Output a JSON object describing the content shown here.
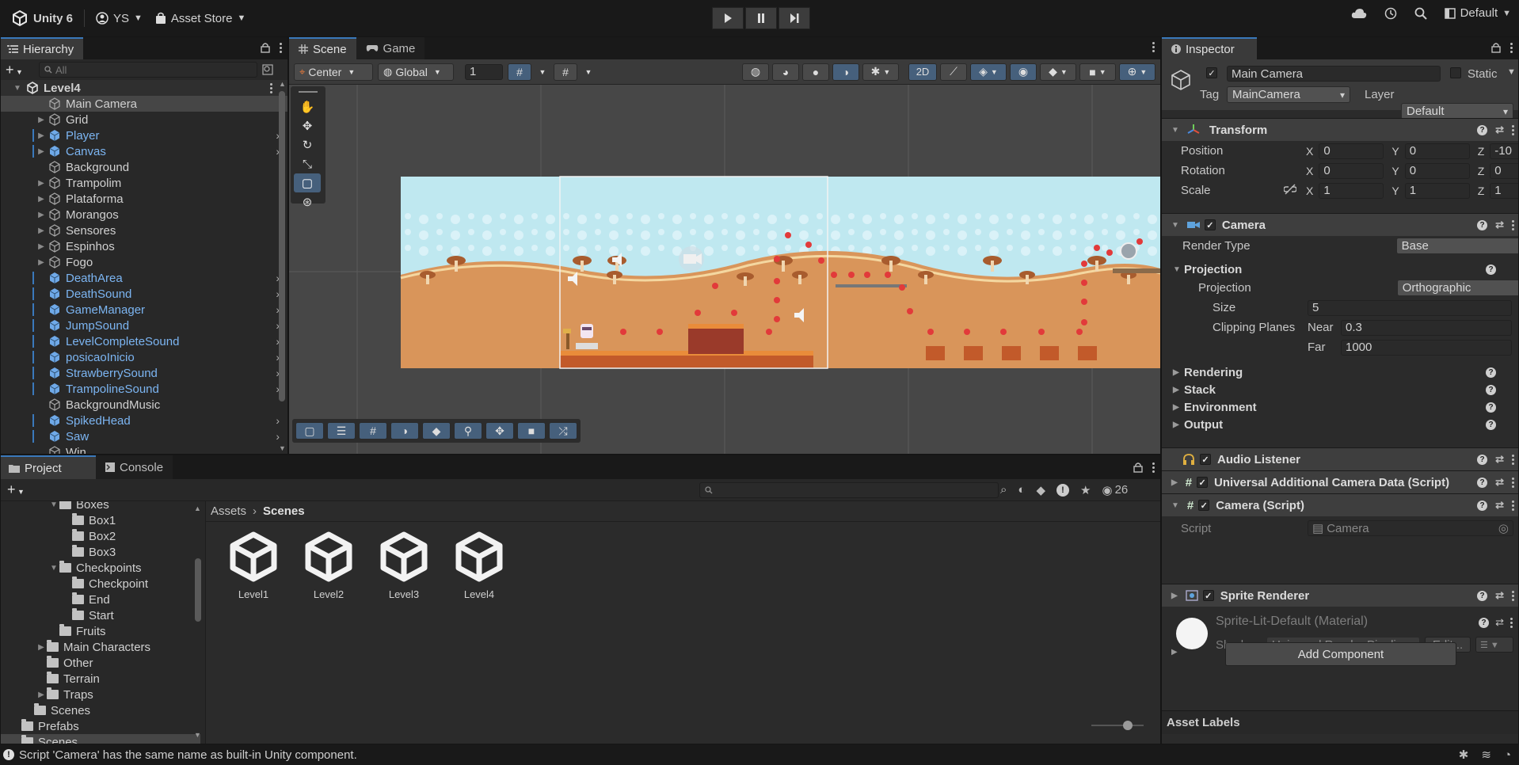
{
  "topbar": {
    "app_name": "Unity 6",
    "account": "YS",
    "asset_store": "Asset Store",
    "layout": "Default"
  },
  "hierarchy": {
    "tab": "Hierarchy",
    "search_placeholder": "All",
    "scene_name": "Level4",
    "items": [
      {
        "label": "Main Camera",
        "prefab": false,
        "fold": false,
        "selected": true,
        "chev": false
      },
      {
        "label": "Grid",
        "prefab": false,
        "fold": true,
        "chev": false
      },
      {
        "label": "Player",
        "prefab": true,
        "fold": true,
        "chev": true
      },
      {
        "label": "Canvas",
        "prefab": true,
        "fold": true,
        "chev": true
      },
      {
        "label": "Background",
        "prefab": false,
        "fold": false,
        "chev": false
      },
      {
        "label": "Trampolim",
        "prefab": false,
        "fold": true,
        "chev": false
      },
      {
        "label": "Plataforma",
        "prefab": false,
        "fold": true,
        "chev": false
      },
      {
        "label": "Morangos",
        "prefab": false,
        "fold": true,
        "chev": false
      },
      {
        "label": "Sensores",
        "prefab": false,
        "fold": true,
        "chev": false
      },
      {
        "label": "Espinhos",
        "prefab": false,
        "fold": true,
        "chev": false
      },
      {
        "label": "Fogo",
        "prefab": false,
        "fold": true,
        "chev": false
      },
      {
        "label": "DeathArea",
        "prefab": true,
        "fold": false,
        "chev": true
      },
      {
        "label": "DeathSound",
        "prefab": true,
        "fold": false,
        "chev": true
      },
      {
        "label": "GameManager",
        "prefab": true,
        "fold": false,
        "chev": true
      },
      {
        "label": "JumpSound",
        "prefab": true,
        "fold": false,
        "chev": true
      },
      {
        "label": "LevelCompleteSound",
        "prefab": true,
        "fold": false,
        "chev": true
      },
      {
        "label": "posicaoInicio",
        "prefab": true,
        "fold": false,
        "chev": true
      },
      {
        "label": "StrawberrySound",
        "prefab": true,
        "fold": false,
        "chev": true
      },
      {
        "label": "TrampolineSound",
        "prefab": true,
        "fold": false,
        "chev": true
      },
      {
        "label": "BackgroundMusic",
        "prefab": false,
        "fold": false,
        "chev": false
      },
      {
        "label": "SpikedHead",
        "prefab": true,
        "fold": false,
        "chev": true
      },
      {
        "label": "Saw",
        "prefab": true,
        "fold": false,
        "chev": true
      },
      {
        "label": "Win",
        "prefab": false,
        "fold": false,
        "chev": false
      }
    ]
  },
  "scene": {
    "tabs": [
      "Scene",
      "Game"
    ],
    "pivot": "Center",
    "space": "Global",
    "grid_size": "1",
    "mode_2d": "2D"
  },
  "inspector": {
    "tab": "Inspector",
    "object_name": "Main Camera",
    "static_label": "Static",
    "tag_label": "Tag",
    "tag_value": "MainCamera",
    "layer_label": "Layer",
    "layer_value": "Default",
    "transform": {
      "title": "Transform",
      "position_label": "Position",
      "rotation_label": "Rotation",
      "scale_label": "Scale",
      "position": [
        "0",
        "0",
        "-10"
      ],
      "rotation": [
        "0",
        "0",
        "0"
      ],
      "scale": [
        "1",
        "1",
        "1"
      ]
    },
    "camera": {
      "title": "Camera",
      "render_type_label": "Render Type",
      "render_type": "Base",
      "projection_section": "Projection",
      "projection_label": "Projection",
      "projection": "Orthographic",
      "size_label": "Size",
      "size": "5",
      "clipping_label": "Clipping Planes",
      "near_label": "Near",
      "near": "0.3",
      "far_label": "Far",
      "far": "1000",
      "sections": [
        "Rendering",
        "Stack",
        "Environment",
        "Output"
      ]
    },
    "audio_listener": "Audio Listener",
    "ucad": "Universal Additional Camera Data (Script)",
    "camera_script": {
      "title": "Camera (Script)",
      "script_label": "Script",
      "script_value": "Camera"
    },
    "sprite_renderer": {
      "title": "Sprite Renderer",
      "material": "Sprite-Lit-Default (Material)",
      "shader_label": "Shader",
      "shader_value": "Universal Render Pipelin",
      "edit": "Edit..."
    },
    "add_component": "Add Component",
    "asset_labels": "Asset Labels"
  },
  "project": {
    "tabs": [
      "Project",
      "Console"
    ],
    "count": "26",
    "tree": [
      {
        "label": "Boxes",
        "indent": 4,
        "fold": "open"
      },
      {
        "label": "Box1",
        "indent": 5,
        "fold": ""
      },
      {
        "label": "Box2",
        "indent": 5,
        "fold": ""
      },
      {
        "label": "Box3",
        "indent": 5,
        "fold": ""
      },
      {
        "label": "Checkpoints",
        "indent": 4,
        "fold": "open"
      },
      {
        "label": "Checkpoint",
        "indent": 5,
        "fold": ""
      },
      {
        "label": "End",
        "indent": 5,
        "fold": ""
      },
      {
        "label": "Start",
        "indent": 5,
        "fold": ""
      },
      {
        "label": "Fruits",
        "indent": 4,
        "fold": ""
      },
      {
        "label": "Main Characters",
        "indent": 3,
        "fold": "closed"
      },
      {
        "label": "Other",
        "indent": 3,
        "fold": ""
      },
      {
        "label": "Terrain",
        "indent": 3,
        "fold": ""
      },
      {
        "label": "Traps",
        "indent": 3,
        "fold": "closed"
      },
      {
        "label": "Scenes",
        "indent": 2,
        "fold": ""
      },
      {
        "label": "Prefabs",
        "indent": 1,
        "fold": ""
      },
      {
        "label": "Scenes",
        "indent": 1,
        "fold": "",
        "selected": true
      }
    ],
    "breadcrumb": [
      "Assets",
      "Scenes"
    ],
    "assets": [
      "Level1",
      "Level2",
      "Level3",
      "Level4"
    ]
  },
  "status": {
    "message": "Script 'Camera' has the same name as built-in Unity component."
  }
}
